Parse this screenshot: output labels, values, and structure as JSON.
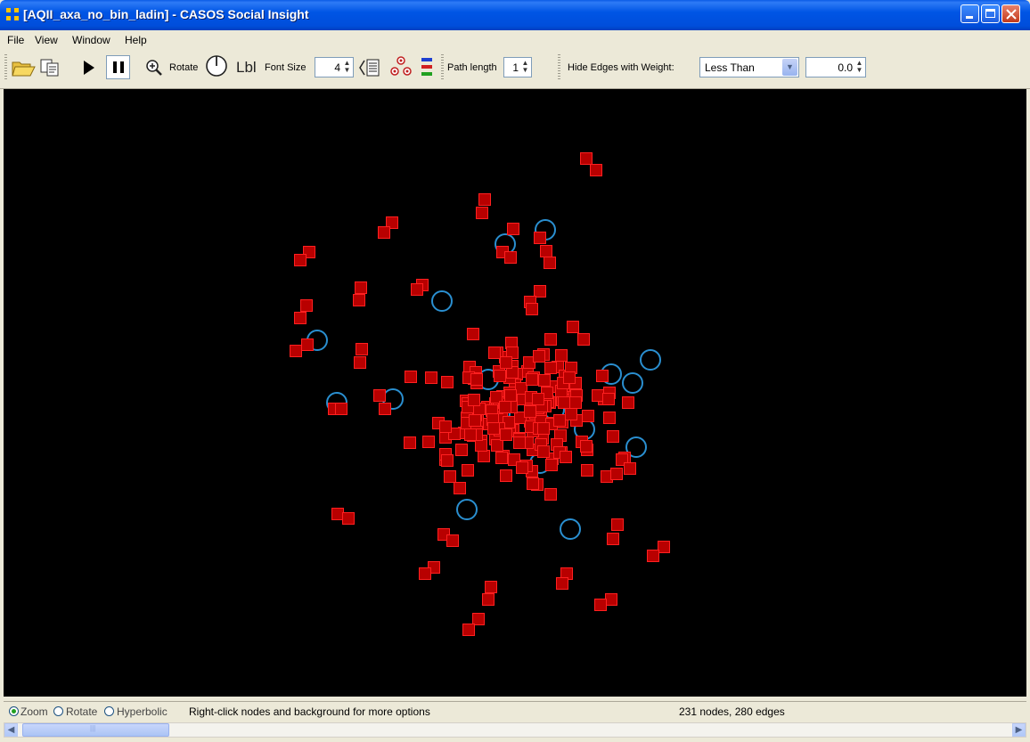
{
  "window": {
    "title": "[AQII_axa_no_bin_ladin] - CASOS Social Insight",
    "buttons": [
      "minimize",
      "maximize",
      "close"
    ]
  },
  "menu": [
    "File",
    "View",
    "Window",
    "Help"
  ],
  "toolbar": {
    "rotate_label": "Rotate",
    "lbl_label": "Lbl",
    "font_size_label": "Font Size",
    "font_size_value": "4",
    "path_length_label": "Path length",
    "path_length_value": "1",
    "hide_edges_label": "Hide Edges with Weight:",
    "hide_edges_option": "Less Than",
    "hide_edges_value": "0.0"
  },
  "icons": [
    "open-folder-icon",
    "copy-icon",
    "play-icon",
    "pause-icon",
    "zoom-icon",
    "rotate-dial-icon",
    "label-toggle-icon",
    "group-icon",
    "legend-icon"
  ],
  "graph": {
    "background": "#000000",
    "node_color": "#B80000",
    "node_border": "#FF2020",
    "loop_color": "#2A8FD0"
  },
  "status": {
    "modes": [
      {
        "label": "Zoom",
        "selected": true
      },
      {
        "label": "Rotate",
        "selected": false
      },
      {
        "label": "Hyperbolic",
        "selected": false
      }
    ],
    "hint": "Right-click nodes and background for more options",
    "counts": "231 nodes, 280 edges"
  }
}
